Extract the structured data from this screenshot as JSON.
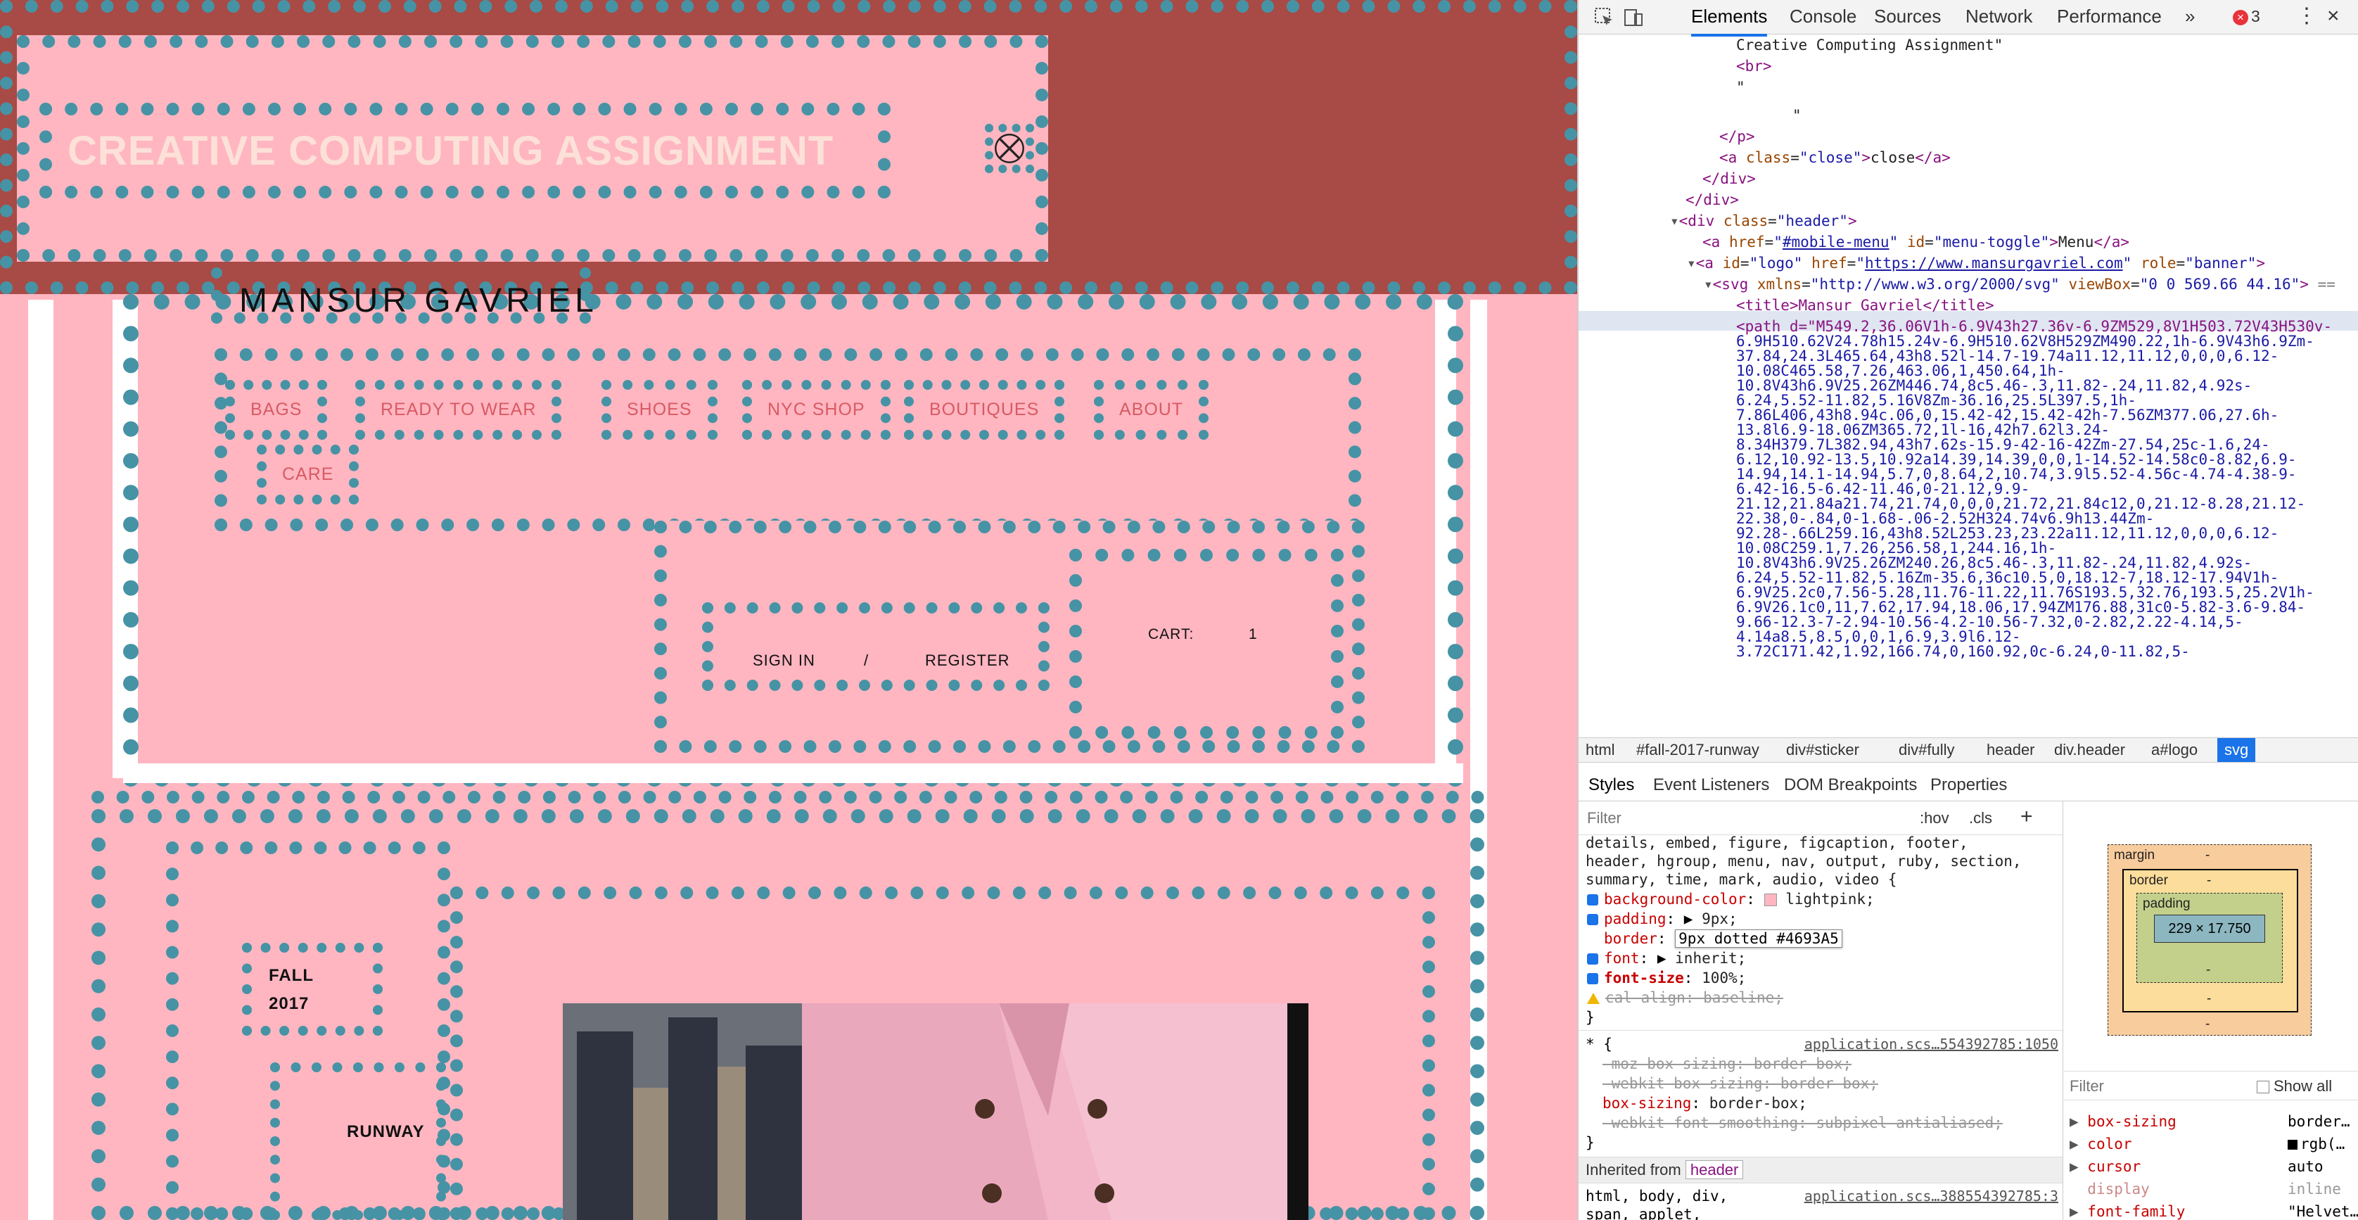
{
  "page": {
    "sticker_title": "CREATIVE COMPUTING ASSIGNMENT",
    "logo_text": "MANSUR GAVRIEL",
    "nav": [
      "BAGS",
      "READY TO WEAR",
      "SHOES",
      "NYC SHOP",
      "BOUTIQUES",
      "ABOUT",
      "CARE"
    ],
    "sign_in": "SIGN IN",
    "separator": "/",
    "register": "REGISTER",
    "cart_label": "CART:",
    "cart_count": "1",
    "fall": "FALL",
    "year": "2017",
    "runway": "RUNWAY"
  },
  "colors": {
    "pink": "#ffb6c1",
    "banner": "#a84a45",
    "dots": "#4693A5",
    "nav_text": "#d85a63",
    "title_text": "#fce1d8"
  },
  "devtools": {
    "tabs": [
      "Elements",
      "Console",
      "Sources",
      "Network",
      "Performance",
      "»"
    ],
    "error_count": "3",
    "dom": {
      "l0": "Creative Computing Assignment\"",
      "l1": "<br>",
      "l2": "\"",
      "l3": "\"",
      "l4": "</p>",
      "l5_tag": "a",
      "l5_attr": "class",
      "l5_val": "close",
      "l5_text": "close",
      "l6": "</div>",
      "l7": "</div>",
      "l8_val": "header",
      "l9_href": "#mobile-menu",
      "l9_id": "menu-toggle",
      "l9_text": "Menu",
      "l10_href": "https://www.mansurgavriel.com",
      "l10_role": "banner",
      "l11_xmlns": "http://www.w3.org/2000/svg",
      "l11_viewbox": "0 0 569.66 44.16",
      "l12": "<title>Mansur Gavriel</title>",
      "path_lines": [
        "<path d=\"M549.2,36.06V1h-6.9V43h27.36v-6.9ZM529,8V1H503.72V43H530v-",
        "6.9H510.62V24.78h15.24v-6.9H510.62V8H529ZM490.22,1h-6.9V43h6.9Zm-",
        "37.84,24.3L465.64,43h8.52l-14.7-19.74a11.12,11.12,0,0,0,6.12-",
        "10.08C465.58,7.26,463.06,1,450.64,1h-",
        "10.8V43h6.9V25.26ZM446.74,8c5.46-.3,11.82-.24,11.82,4.92s-",
        "6.24,5.52-11.82,5.16V8Zm-36.16,25.5L397.5,1h-",
        "7.86L406,43h8.94c.06,0,15.42-42,15.42-42h-7.56ZM377.06,27.6h-",
        "13.8l6.9-18.06ZM365.72,1l-16,42h7.62l3.24-",
        "8.34H379.7L382.94,43h7.62s-15.9-42-16-42Zm-27.54,25c-1.6,24-",
        "6.12,10.92-13.5,10.92a14.39,14.39,0,0,1-14.52-14.58c0-8.82,6.9-",
        "14.94,14.1-14.94,5.7,0,8.64,2,10.74,3.9l5.52-4.56c-4.74-4.38-9-",
        "6.42-16.5-6.42-11.46,0-21.12,9.9-",
        "21.12,21.84a21.74,21.74,0,0,0,21.72,21.84c12,0,21.12-8.28,21.12-",
        "22.38,0-.84,0-1.68-.06-2.52H324.74v6.9h13.44Zm-",
        "92.28-.66L259.16,43h8.52L253.23,23.22a11.12,11.12,0,0,0,6.12-",
        "10.08C259.1,7.26,256.58,1,244.16,1h-",
        "10.8V43h6.9V25.26ZM240.26,8c5.46-.3,11.82-.24,11.82,4.92s-",
        "6.24,5.52-11.82,5.16Zm-35.6,36c10.5,0,18.12-7,18.12-17.94V1h-",
        "6.9V25.2c0,7.56-5.28,11.76-11.22,11.76S193.5,32.76,193.5,25.2V1h-",
        "6.9V26.1c0,11,7.62,17.94,18.06,17.94ZM176.88,31c0-5.82-3.6-9.84-",
        "9.66-12.3-7-2.94-10.56-4.2-10.56-7.32,0-2.82,2.22-4.14,5-",
        "4.14a8.5,8.5,0,0,1,6.9,3.9l6.12-",
        "3.72C171.42,1.92,166.74,0,160.92,0c-6.24,0-11.82,5-"
      ]
    },
    "crumbs": [
      "html",
      "#fall-2017-runway",
      "div#sticker",
      "div#fully",
      "header",
      "div.header",
      "a#logo",
      "svg"
    ],
    "lower_tabs": [
      "Styles",
      "Event Listeners",
      "DOM Breakpoints",
      "Properties"
    ],
    "filter_placeholder": "Filter",
    "hov": ":hov",
    "cls": ".cls",
    "plus": "+",
    "styles": {
      "sel_line1": "details, embed, figure, figcaption, footer,",
      "sel_line2": "header, hgroup, menu, nav, output, ruby, section,",
      "sel_line3": "summary, time, mark, audio, video {",
      "p1": "background-color",
      "v1": "lightpink;",
      "p2": "padding",
      "v2": "9px;",
      "p3": "border",
      "v3": "9px dotted #4693A5",
      "p4": "font",
      "v4": "inherit;",
      "p5": "font-size",
      "v5": "100%;",
      "p6": "cal-align",
      "v6": "baseline;",
      "close1": "}",
      "univ": "* {",
      "src1": "application.scs…554392785:1050",
      "s1": "-moz-box-sizing: border-box;",
      "s2": "-webkit-box-sizing: border-box;",
      "s3p": "box-sizing",
      "s3v": "border-box;",
      "s4": "-webkit-font-smoothing: subpixel-antialiased;",
      "close2": "}",
      "inherited_label": "Inherited from",
      "inherited_tag": "header",
      "last1": "html, body, div,",
      "last2": "span, applet,",
      "src2": "application.scs…388554392785:3"
    },
    "boxmodel": {
      "margin": "margin",
      "border": "border",
      "padding": "padding",
      "dash": "-",
      "content": "229 × 17.750"
    },
    "computed": {
      "filter": "Filter",
      "show_all": "Show all",
      "rows": [
        {
          "p": "box-sizing",
          "v": "border…"
        },
        {
          "p": "color",
          "v": "rgb(…"
        },
        {
          "p": "cursor",
          "v": "auto"
        },
        {
          "p": "display",
          "v": "inline"
        },
        {
          "p": "font-family",
          "v": "\"Helvet…"
        }
      ]
    }
  }
}
